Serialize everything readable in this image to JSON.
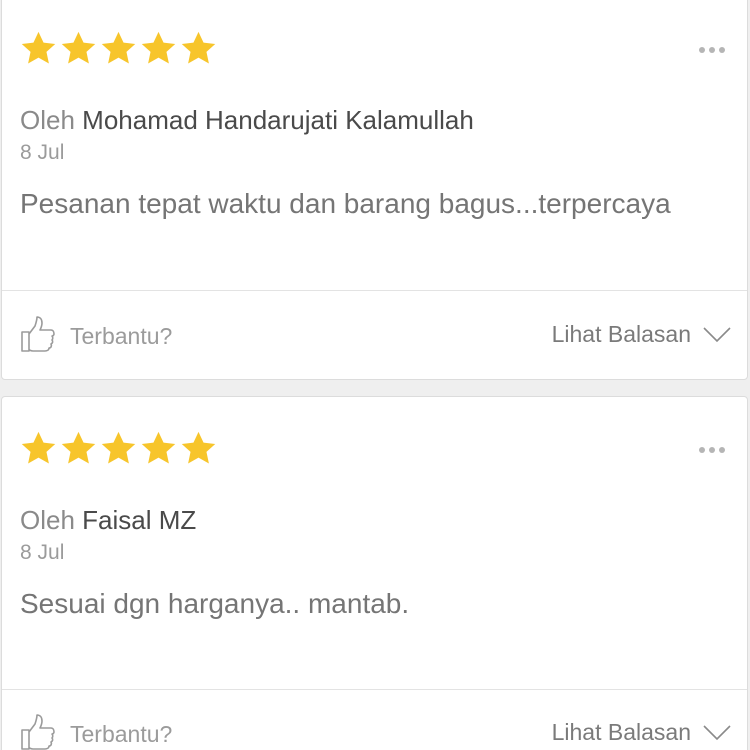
{
  "colors": {
    "star": "#f7c52b",
    "card_background": "#ffffff",
    "page_background": "#efefef"
  },
  "reviews": [
    {
      "rating": 5,
      "by_prefix": "Oleh",
      "reviewer": "Mohamad Handarujati Kalamullah",
      "date": "8 Jul",
      "text": "Pesanan tepat waktu dan barang bagus...terpercaya",
      "helpful_label": "Terbantu?",
      "replies_label": "Lihat Balasan"
    },
    {
      "rating": 5,
      "by_prefix": "Oleh",
      "reviewer": "Faisal MZ",
      "date": "8 Jul",
      "text": "Sesuai dgn harganya.. mantab.",
      "helpful_label": "Terbantu?",
      "replies_label": "Lihat Balasan"
    }
  ],
  "icons": {
    "star": "star-icon",
    "more": "more-options-icon",
    "like": "thumbs-up-icon",
    "expand": "chevron-down-icon"
  }
}
